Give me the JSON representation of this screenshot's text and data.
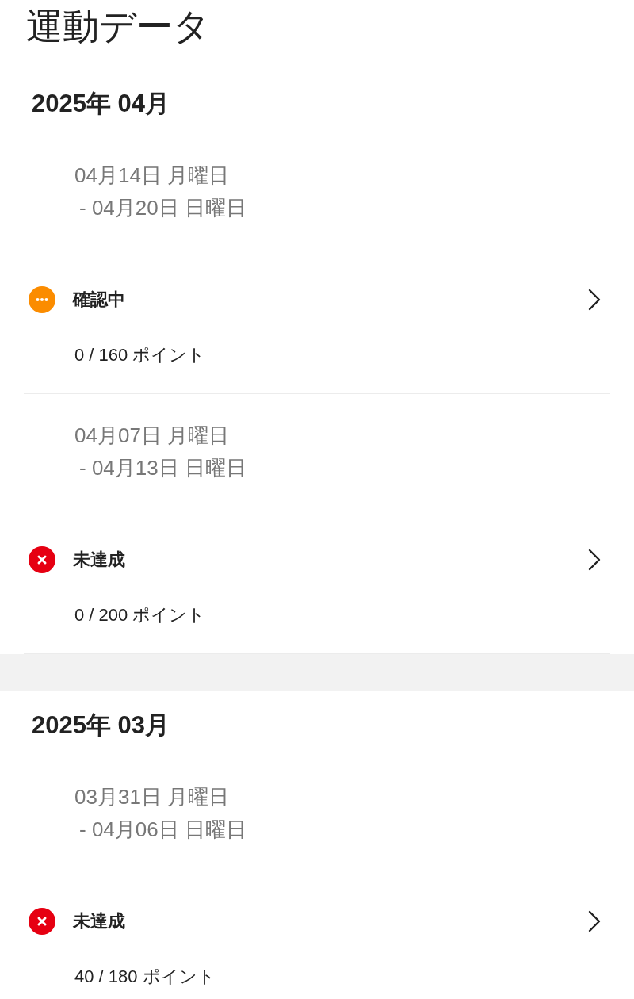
{
  "title": "運動データ",
  "months": [
    {
      "heading": "2025年 04月",
      "weeks": [
        {
          "date_start": "04月14日 月曜日",
          "date_end": "- 04月20日 日曜日",
          "status": {
            "kind": "pending",
            "label": "確認中"
          },
          "points": "0 / 160 ポイント"
        },
        {
          "date_start": "04月07日 月曜日",
          "date_end": "- 04月13日 日曜日",
          "status": {
            "kind": "failed",
            "label": "未達成"
          },
          "points": "0 / 200 ポイント"
        }
      ]
    },
    {
      "heading": "2025年 03月",
      "weeks": [
        {
          "date_start": "03月31日 月曜日",
          "date_end": "- 04月06日 日曜日",
          "status": {
            "kind": "failed",
            "label": "未達成"
          },
          "points": "40 / 180 ポイント"
        }
      ]
    }
  ]
}
